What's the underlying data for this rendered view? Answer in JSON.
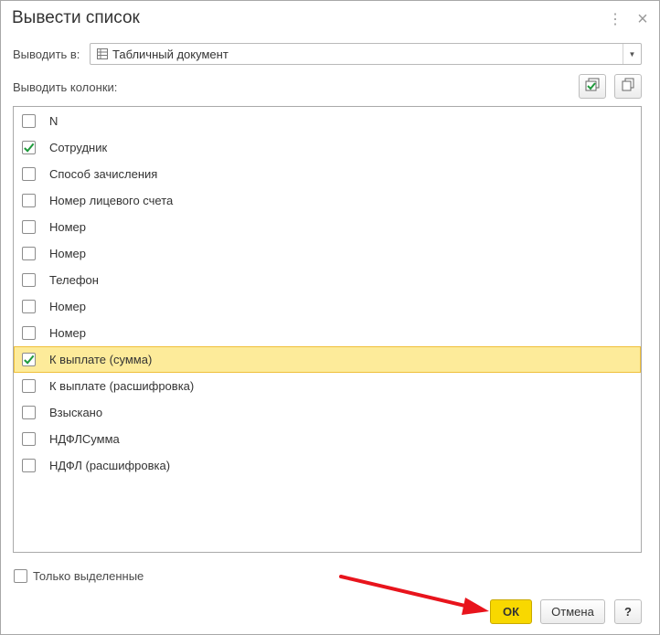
{
  "window": {
    "title": "Вывести список",
    "more_icon": "more-vertical-icon",
    "close_icon": "close-icon"
  },
  "output": {
    "label": "Выводить в:",
    "value": "Табличный документ",
    "icon": "spreadsheet-document-icon"
  },
  "columns": {
    "label": "Выводить колонки:",
    "check_all_icon": "check-all-icon",
    "copy_icon": "copy-icon",
    "items": [
      {
        "label": "N",
        "checked": false
      },
      {
        "label": "Сотрудник",
        "checked": true
      },
      {
        "label": "Способ зачисления",
        "checked": false
      },
      {
        "label": "Номер лицевого счета",
        "checked": false
      },
      {
        "label": "Номер",
        "checked": false
      },
      {
        "label": "Номер",
        "checked": false
      },
      {
        "label": "Телефон",
        "checked": false
      },
      {
        "label": "Номер",
        "checked": false
      },
      {
        "label": "Номер",
        "checked": false
      },
      {
        "label": "К выплате (сумма)",
        "checked": true,
        "selected": true
      },
      {
        "label": "К выплате (расшифровка)",
        "checked": false
      },
      {
        "label": "Взыскано",
        "checked": false
      },
      {
        "label": "НДФЛСумма",
        "checked": false
      },
      {
        "label": "НДФЛ (расшифровка)",
        "checked": false
      }
    ]
  },
  "only_selected": {
    "label": "Только выделенные",
    "checked": false
  },
  "buttons": {
    "ok": "ОК",
    "cancel": "Отмена",
    "help": "?"
  },
  "colors": {
    "accent_ok": "#f8d800",
    "selected_row": "#fdeb9a",
    "check_mark": "#1f9a3c",
    "annotation_arrow": "#e8141c"
  }
}
